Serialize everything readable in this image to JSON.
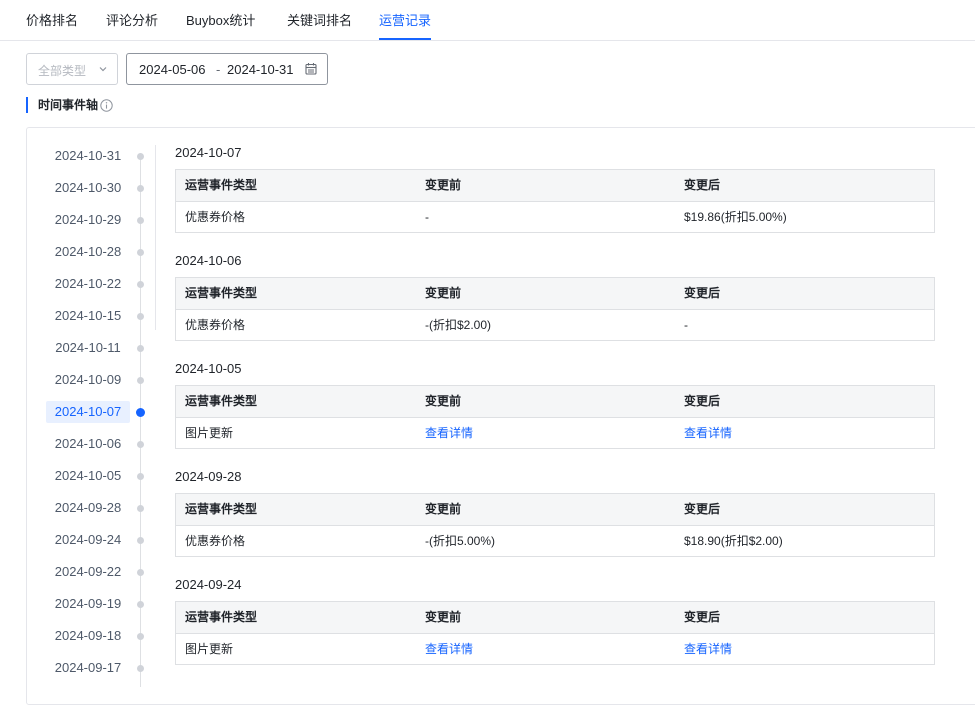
{
  "tabs": [
    {
      "label": "价格排名"
    },
    {
      "label": "评论分析"
    },
    {
      "label": "Buybox统计"
    },
    {
      "label": "关键词排名"
    },
    {
      "label": "运营记录",
      "active": true
    }
  ],
  "filters": {
    "type_placeholder": "全部类型",
    "date_start": "2024-05-06",
    "date_separator": "-",
    "date_end": "2024-10-31"
  },
  "section": {
    "title": "时间事件轴",
    "icon": "info-icon"
  },
  "timeline": {
    "dates": [
      "2024-10-31",
      "2024-10-30",
      "2024-10-29",
      "2024-10-28",
      "2024-10-22",
      "2024-10-15",
      "2024-10-11",
      "2024-10-09",
      "2024-10-07",
      "2024-10-06",
      "2024-10-05",
      "2024-09-28",
      "2024-09-24",
      "2024-09-22",
      "2024-09-19",
      "2024-09-18",
      "2024-09-17"
    ],
    "selected": "2024-10-07"
  },
  "events": [
    {
      "date": "2024-10-07",
      "headers": [
        "运营事件类型",
        "变更前",
        "变更后"
      ],
      "row": {
        "type": "优惠券价格",
        "before": "-",
        "after": "$19.86(折扣5.00%)"
      }
    },
    {
      "date": "2024-10-06",
      "headers": [
        "运营事件类型",
        "变更前",
        "变更后"
      ],
      "row": {
        "type": "优惠券价格",
        "before": "-(折扣$2.00)",
        "after": "-"
      }
    },
    {
      "date": "2024-10-05",
      "headers": [
        "运营事件类型",
        "变更前",
        "变更后"
      ],
      "row": {
        "type": "图片更新",
        "before": "查看详情",
        "after": "查看详情"
      }
    },
    {
      "date": "2024-09-28",
      "headers": [
        "运营事件类型",
        "变更前",
        "变更后"
      ],
      "row": {
        "type": "优惠券价格",
        "before": "-(折扣5.00%)",
        "after": "$18.90(折扣$2.00)"
      }
    },
    {
      "date": "2024-09-24",
      "headers": [
        "运营事件类型",
        "变更前",
        "变更后"
      ],
      "row": {
        "type": "图片更新",
        "before": "查看详情",
        "after": "查看详情"
      }
    }
  ],
  "colors": {
    "accent": "#1664ff",
    "header_bg": "#f5f6f7",
    "border": "#dee0e3"
  }
}
